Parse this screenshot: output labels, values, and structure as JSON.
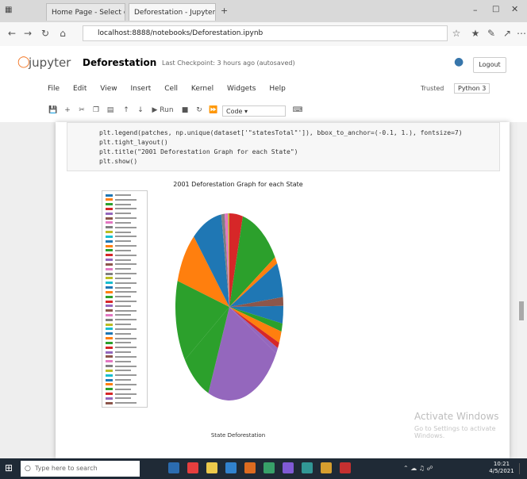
{
  "browser": {
    "tabs": [
      {
        "label": "Home Page - Select or crea",
        "active": false
      },
      {
        "label": "Deforestation - Jupyter",
        "active": true
      }
    ],
    "url": "localhost:8888/notebooks/Deforestation.ipynb"
  },
  "jupyter": {
    "logo_text": "jupyter",
    "notebook_title": "Deforestation",
    "checkpoint": "Last Checkpoint: 3 hours ago  (autosaved)",
    "logout_label": "Logout",
    "menu": [
      "File",
      "Edit",
      "View",
      "Insert",
      "Cell",
      "Kernel",
      "Widgets",
      "Help"
    ],
    "trusted_label": "Trusted",
    "kernel_label": "Python 3",
    "cell_type": "Code",
    "run_label": "Run"
  },
  "code": [
    "plt.legend(patches, np.unique(dataset['\"statesTotal\"']), bbox_to_anchor=(-0.1, 1.), fontsize=7)",
    "plt.tight_layout()",
    "plt.title(\"2001 Deforestation Graph for each State\")",
    "plt.show()"
  ],
  "chart_data": {
    "type": "pie",
    "title": "2001 Deforestation Graph for each State",
    "xlabel": "State Deforestation",
    "ylabel": "",
    "legend_position": "left",
    "slices": [
      {
        "label": "",
        "value": 4.0,
        "color": "#d62728"
      },
      {
        "label": "",
        "value": 12.0,
        "color": "#2ca02c"
      },
      {
        "label": "",
        "value": 1.2,
        "color": "#ff7f0e"
      },
      {
        "label": "",
        "value": 6.0,
        "color": "#1f77b4"
      },
      {
        "label": "",
        "value": 1.5,
        "color": "#8c564b"
      },
      {
        "label": "",
        "value": 3.0,
        "color": "#1f77b4"
      },
      {
        "label": "",
        "value": 1.4,
        "color": "#2ca02c"
      },
      {
        "label": "",
        "value": 2.0,
        "color": "#ff7f0e"
      },
      {
        "label": "",
        "value": 1.0,
        "color": "#d62728"
      },
      {
        "label": "",
        "value": 1.0,
        "color": "#9467bd"
      },
      {
        "label": "",
        "value": 23.0,
        "color": "#9467bd"
      },
      {
        "label": "",
        "value": 9.0,
        "color": "#2ca02c"
      },
      {
        "label": "",
        "value": 14.0,
        "color": "#2ca02c"
      },
      {
        "label": "",
        "value": 9.0,
        "color": "#ff7f0e"
      },
      {
        "label": "",
        "value": 9.0,
        "color": "#1f77b4"
      },
      {
        "label": "",
        "value": 1.0,
        "color": "#7f7f7f"
      },
      {
        "label": "",
        "value": 1.0,
        "color": "#e377c2"
      },
      {
        "label": "",
        "value": 0.4,
        "color": "#bcbd22"
      }
    ],
    "legend_colors": [
      "#1f77b4",
      "#ff7f0e",
      "#2ca02c",
      "#d62728",
      "#9467bd",
      "#8c564b",
      "#e377c2",
      "#7f7f7f",
      "#bcbd22",
      "#17becf",
      "#1f77b4",
      "#ff7f0e",
      "#2ca02c",
      "#d62728",
      "#9467bd",
      "#8c564b",
      "#e377c2",
      "#7f7f7f",
      "#bcbd22",
      "#17becf",
      "#1f77b4",
      "#ff7f0e",
      "#2ca02c",
      "#d62728",
      "#9467bd",
      "#8c564b",
      "#e377c2",
      "#7f7f7f",
      "#bcbd22",
      "#17becf",
      "#1f77b4",
      "#ff7f0e",
      "#2ca02c",
      "#d62728",
      "#9467bd",
      "#8c564b",
      "#e377c2",
      "#7f7f7f",
      "#bcbd22",
      "#17becf",
      "#1f77b4",
      "#ff7f0e",
      "#2ca02c",
      "#d62728",
      "#9467bd",
      "#8c564b"
    ]
  },
  "watermark": {
    "line1": "Activate Windows",
    "line2": "Go to Settings to activate Windows."
  },
  "taskbar": {
    "search_placeholder": "Type here to search",
    "time": "10:21",
    "date": "4/5/2021",
    "apps": [
      "#2b6cb0",
      "#e53e3e",
      "#ecc94b",
      "#3182ce",
      "#dd6b20",
      "#38a169",
      "#805ad5",
      "#319795",
      "#d69e2e",
      "#c53030"
    ]
  }
}
